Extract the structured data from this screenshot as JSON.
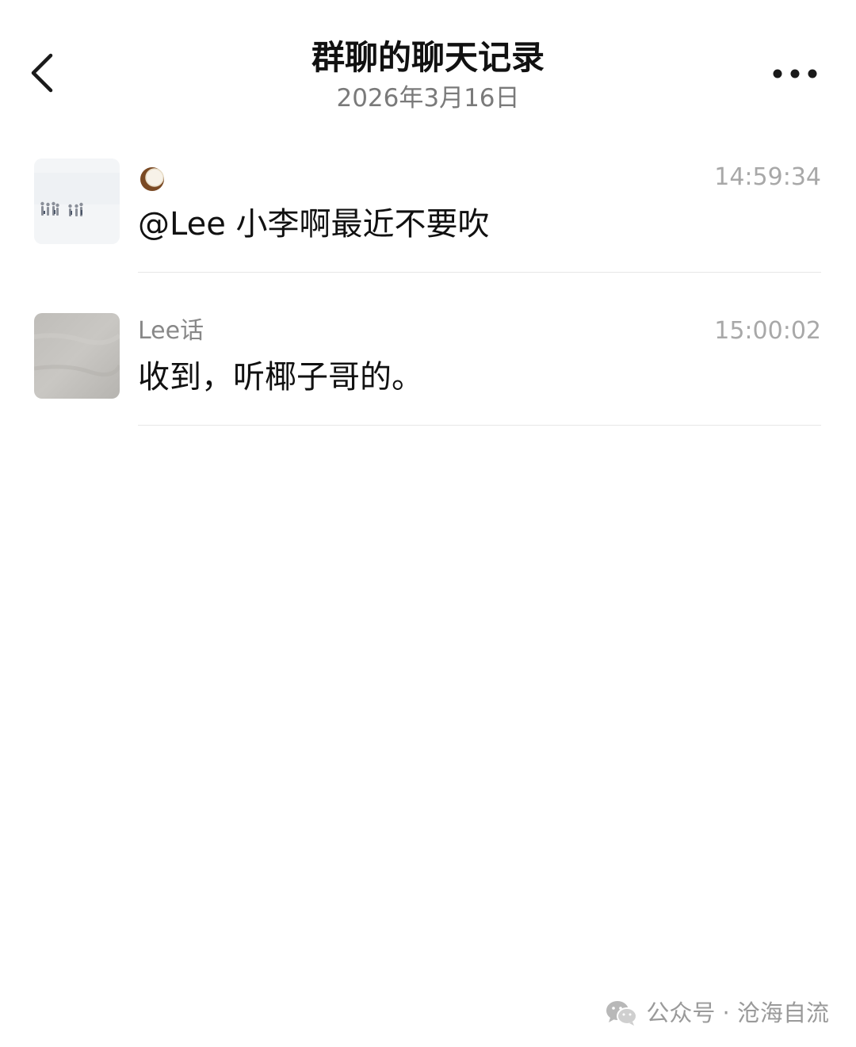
{
  "header": {
    "title": "群聊的聊天记录",
    "date": "2026年3月16日",
    "back_icon": "chevron-left-icon",
    "more_icon": "more-horizontal-icon"
  },
  "messages": [
    {
      "sender": "🥥",
      "time": "14:59:34",
      "text": "@Lee 小李啊最近不要吹",
      "avatar": "group-photo-avatar"
    },
    {
      "sender": "Lee话",
      "time": "15:00:02",
      "text": "收到，听椰子哥的。",
      "avatar": "gray-texture-avatar"
    }
  ],
  "watermark": {
    "icon": "wechat-icon",
    "text": "公众号 · 沧海自流"
  },
  "colors": {
    "title": "#111111",
    "subtitle": "#7a7a7a",
    "sender": "#888888",
    "time": "#a8a8a8",
    "divider": "#e6e6e6"
  }
}
